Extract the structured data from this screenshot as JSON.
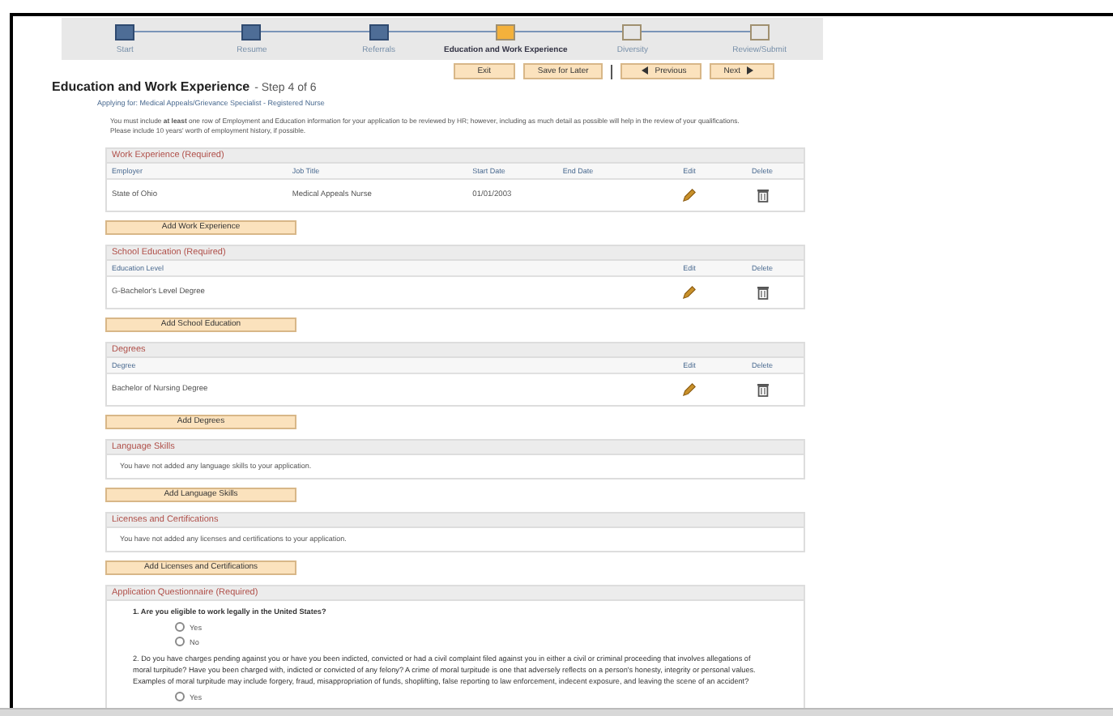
{
  "steps": [
    {
      "label": "Start",
      "completed": true,
      "selected": false
    },
    {
      "label": "Resume",
      "completed": true,
      "selected": false
    },
    {
      "label": "Referrals",
      "completed": true,
      "selected": false
    },
    {
      "label": "Education and Work Experience",
      "completed": false,
      "selected": true
    },
    {
      "label": "Diversity",
      "completed": false,
      "selected": false
    },
    {
      "label": "Review/Submit",
      "completed": false,
      "selected": false
    }
  ],
  "nav_buttons": [
    {
      "label": "Exit",
      "kind": "plain"
    },
    {
      "label": "Save for Later",
      "kind": "plain"
    },
    {
      "label": "Previous",
      "kind": "prev"
    },
    {
      "label": "Next",
      "kind": "next"
    }
  ],
  "title": "Education and Work Experience",
  "step_text": "- Step 4 of 6",
  "applying_for": "Applying for: Medical Appeals/Grievance Specialist - Registered Nurse",
  "intro": "You must include **at least** one row of Employment and Education information for your application to be reviewed by HR; however, including as much detail as possible will help in the review of your qualifications. Please include 10 years' worth of employment history, if possible.",
  "sections": [
    {
      "kind": "table",
      "header": "Work Experience (Required)",
      "columns": [
        {
          "label": "Employer",
          "kind": "text"
        },
        {
          "label": "Job Title",
          "kind": "text"
        },
        {
          "label": "Start Date",
          "kind": "text"
        },
        {
          "label": "End Date",
          "kind": "text"
        },
        {
          "label": "Edit",
          "kind": "edit"
        },
        {
          "label": "Delete",
          "kind": "delete"
        }
      ],
      "rows": [
        {
          "cells": [
            "State of Ohio",
            "Medical Appeals Nurse",
            "01/01/2003",
            null
          ]
        }
      ],
      "button": "Add Work Experience"
    },
    {
      "kind": "table",
      "header": "School Education (Required)",
      "columns": [
        {
          "label": "Education Level",
          "kind": "text"
        },
        {
          "label": "Edit",
          "kind": "edit"
        },
        {
          "label": "Delete",
          "kind": "delete"
        }
      ],
      "rows": [
        {
          "cells": [
            "G-Bachelor's Level Degree"
          ]
        }
      ],
      "button": "Add School Education"
    },
    {
      "kind": "table",
      "header": "Degrees",
      "columns": [
        {
          "label": "Degree",
          "kind": "text"
        },
        {
          "label": "Edit",
          "kind": "edit"
        },
        {
          "label": "Delete",
          "kind": "delete"
        }
      ],
      "rows": [
        {
          "cells": [
            "Bachelor of Nursing Degree"
          ]
        }
      ],
      "button": "Add Degrees"
    },
    {
      "kind": "empty",
      "header": "Language Skills",
      "message": "You have not added any language skills to your application.",
      "button": "Add Language Skills"
    },
    {
      "kind": "empty",
      "header": "Licenses and Certifications",
      "message": "You have not added any licenses and certifications to your application.",
      "button": "Add Licenses and Certifications"
    },
    {
      "kind": "questions",
      "header": "Application Questionnaire (Required)",
      "questions": [
        {
          "text": "1. Are you eligible to work legally in the United States?",
          "bold": true,
          "options": [
            {
              "label": "Yes",
              "selected": false
            },
            {
              "label": "No",
              "selected": false
            }
          ]
        },
        {
          "text": "2. Do you have charges pending against you or have you been indicted, convicted or had a civil complaint filed against you in either a civil or criminal proceeding that involves allegations of moral turpitude? Have you been charged with, indicted or convicted of any felony? A crime of moral turpitude is one that adversely reflects on a person's honesty, integrity or personal values. Examples of moral turpitude may include forgery, fraud, misappropriation of funds, shoplifting, false reporting to law enforcement, indecent exposure, and leaving the scene of an accident?",
          "bold": false,
          "options": [
            {
              "label": "Yes",
              "selected": false
            }
          ]
        }
      ]
    }
  ]
}
